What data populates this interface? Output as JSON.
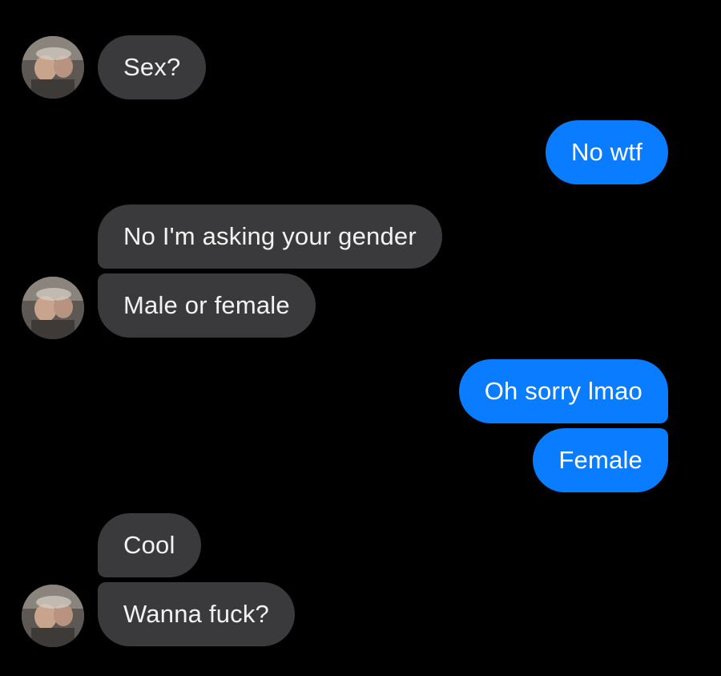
{
  "conversation": {
    "messages": [
      {
        "sender": "other",
        "text": "Sex?"
      },
      {
        "sender": "me",
        "text": "No wtf"
      },
      {
        "sender": "other",
        "text": "No I'm asking your gender"
      },
      {
        "sender": "other",
        "text": "Male or female"
      },
      {
        "sender": "me",
        "text": "Oh sorry lmao"
      },
      {
        "sender": "me",
        "text": "Female"
      },
      {
        "sender": "other",
        "text": "Cool"
      },
      {
        "sender": "other",
        "text": "Wanna fuck?"
      }
    ]
  },
  "colors": {
    "background": "#000000",
    "incoming_bubble": "#3a3a3c",
    "outgoing_bubble": "#0a7cff",
    "text": "#f2f2f2"
  },
  "icons": {
    "avatar": "contact-avatar-photo"
  }
}
